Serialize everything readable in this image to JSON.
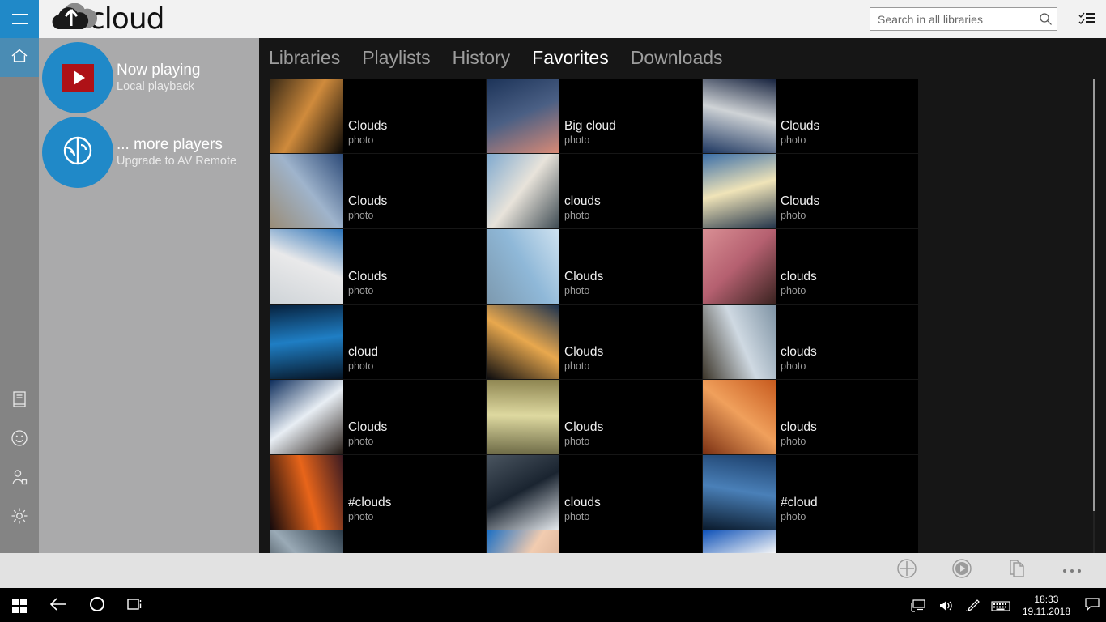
{
  "header": {
    "menu_icon": "hamburger-icon",
    "app_name": "cloud",
    "logo_icon": "av-cloud-logo",
    "search": {
      "value": "",
      "placeholder": "Search in all libraries",
      "icon": "search-icon"
    },
    "select_mode_icon": "checklist-icon"
  },
  "rail": {
    "items": [
      {
        "name": "home",
        "icon": "home-icon",
        "active": true
      },
      {
        "name": "book",
        "icon": "book-icon",
        "active": false
      },
      {
        "name": "feedback",
        "icon": "smiley-icon",
        "active": false
      },
      {
        "name": "account",
        "icon": "user-icon",
        "active": false
      },
      {
        "name": "settings",
        "icon": "gear-icon",
        "active": false
      }
    ]
  },
  "player_panel": {
    "now_playing": {
      "title": "Now playing",
      "subtitle": "Local playback",
      "icon": "play-icon"
    },
    "more_players": {
      "title": "... more players",
      "subtitle": "Upgrade to AV Remote",
      "icon": "cast-icon"
    }
  },
  "main": {
    "tabs": [
      {
        "label": "Libraries",
        "active": false
      },
      {
        "label": "Playlists",
        "active": false
      },
      {
        "label": "History",
        "active": false
      },
      {
        "label": "Favorites",
        "active": true
      },
      {
        "label": "Downloads",
        "active": false
      }
    ],
    "items": [
      {
        "title": "Clouds",
        "subtitle": "photo",
        "c1": "#3a2a16",
        "c2": "#d08b3c",
        "c3": "#0a0806"
      },
      {
        "title": "Big cloud",
        "subtitle": "photo",
        "c1": "#1c3358",
        "c2": "#4a5f84",
        "c3": "#d98a76"
      },
      {
        "title": "Clouds",
        "subtitle": "photo",
        "c1": "#14203c",
        "c2": "#cfd3d6",
        "c3": "#1d3660"
      },
      {
        "title": "Clouds",
        "subtitle": "photo",
        "c1": "#2c4a78",
        "c2": "#9fb4cc",
        "c3": "#9a8d78"
      },
      {
        "title": "clouds",
        "subtitle": "photo",
        "c1": "#7fa9cf",
        "c2": "#e8e3da",
        "c3": "#3d4a52"
      },
      {
        "title": "Clouds",
        "subtitle": "photo",
        "c1": "#3a6ea8",
        "c2": "#f0e4b8",
        "c3": "#23344a"
      },
      {
        "title": "Clouds",
        "subtitle": "photo",
        "c1": "#2a72b8",
        "c2": "#e9e9ea",
        "c3": "#cfd4d8"
      },
      {
        "title": "Clouds",
        "subtitle": "photo",
        "c1": "#cfe2f0",
        "c2": "#8fb8d8",
        "c3": "#7d99ae"
      },
      {
        "title": "clouds",
        "subtitle": "photo",
        "c1": "#d98f94",
        "c2": "#b56070",
        "c3": "#3a2320"
      },
      {
        "title": "cloud",
        "subtitle": "photo",
        "c1": "#06203c",
        "c2": "#1f7ec4",
        "c3": "#061424"
      },
      {
        "title": "Clouds",
        "subtitle": "photo",
        "c1": "#18304f",
        "c2": "#e8a84e",
        "c3": "#0b0b0e"
      },
      {
        "title": "clouds",
        "subtitle": "photo",
        "c1": "#7e93a4",
        "c2": "#cfd9e2",
        "c3": "#3b3428"
      },
      {
        "title": "Clouds",
        "subtitle": "photo",
        "c1": "#0d2d5c",
        "c2": "#e8eef4",
        "c3": "#241a14"
      },
      {
        "title": "Clouds",
        "subtitle": "photo",
        "c1": "#8d8450",
        "c2": "#ded9a0",
        "c3": "#6d6a46"
      },
      {
        "title": "clouds",
        "subtitle": "photo",
        "c1": "#c75a1e",
        "c2": "#f0a05c",
        "c3": "#7a2f12"
      },
      {
        "title": "#clouds",
        "subtitle": "photo",
        "c1": "#3a1a22",
        "c2": "#e8651a",
        "c3": "#150a0c"
      },
      {
        "title": "clouds",
        "subtitle": "photo",
        "c1": "#4a5560",
        "c2": "#1a2430",
        "c3": "#e6eaee"
      },
      {
        "title": "#cloud",
        "subtitle": "photo",
        "c1": "#1b3e6a",
        "c2": "#4a80b8",
        "c3": "#0a1a2c"
      },
      {
        "title": "",
        "subtitle": "",
        "c1": "#2a3a48",
        "c2": "#9aaab6",
        "c3": "#0d141a"
      },
      {
        "title": "",
        "subtitle": "",
        "c1": "#1a6ec4",
        "c2": "#f2ccb0",
        "c3": "#c8a088"
      },
      {
        "title": "",
        "subtitle": "",
        "c1": "#0f52b8",
        "c2": "#f2f4f6",
        "c3": "#1a60c0"
      }
    ],
    "scrollbar": {
      "position": "right",
      "visible": true
    }
  },
  "appbar": {
    "buttons": [
      {
        "name": "add-to",
        "icon": "add-circle-icon"
      },
      {
        "name": "play",
        "icon": "play-circle-icon"
      },
      {
        "name": "copy",
        "icon": "copy-icon"
      },
      {
        "name": "more",
        "icon": "ellipsis-icon"
      }
    ]
  },
  "taskbar": {
    "start_icon": "windows-start-icon",
    "back_icon": "back-arrow-icon",
    "cortana_icon": "cortana-circle-icon",
    "taskview_icon": "task-view-icon",
    "tray": [
      {
        "name": "network",
        "icon": "network-icon"
      },
      {
        "name": "volume",
        "icon": "speaker-icon"
      },
      {
        "name": "pen",
        "icon": "pen-icon"
      },
      {
        "name": "keyboard",
        "icon": "keyboard-icon"
      }
    ],
    "time": "18:33",
    "date": "19.11.2018",
    "action_center_icon": "notification-icon"
  },
  "colors": {
    "accent_blue": "#2089c8",
    "rail_gray": "#848484",
    "panel_gray": "#aaaaab",
    "content_bg": "#161616",
    "appbar_bg": "#e2e2e2",
    "header_bg": "#f2f2f2",
    "play_red": "#ae1117"
  }
}
